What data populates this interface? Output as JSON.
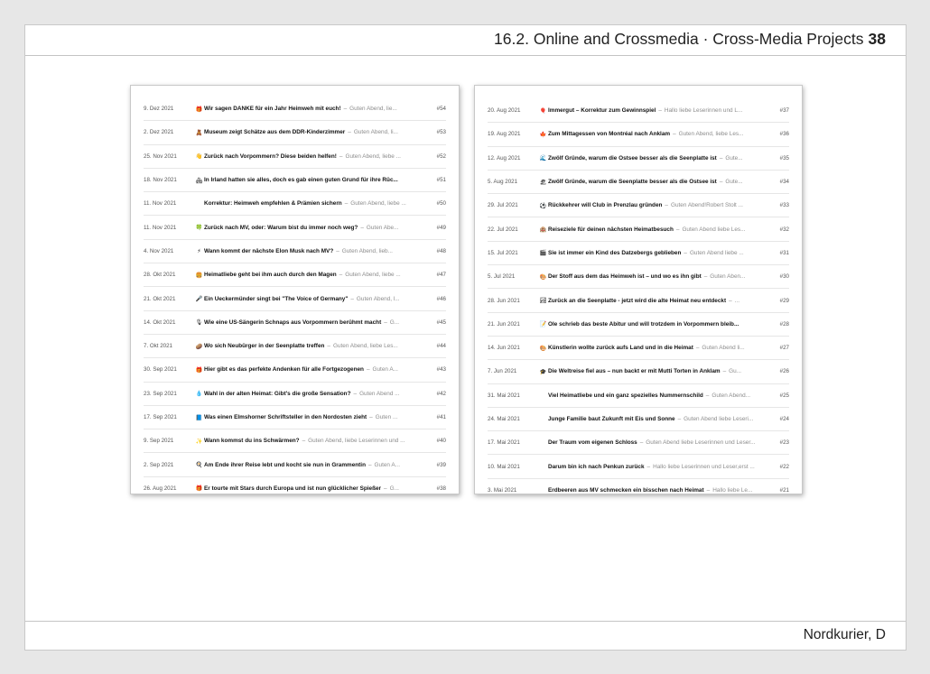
{
  "header": {
    "title": "16.2. Online and Crossmedia · Cross-Media Projects",
    "page": "38"
  },
  "footer": {
    "source": "Nordkurier, D"
  },
  "left_card": {
    "rows": [
      {
        "date": "9. Dez 2021",
        "icon": "🎁",
        "title": "Wir sagen DANKE für ein Jahr Heimweh mit euch!",
        "snippet": "Guten Abend, lie...",
        "num": "#54"
      },
      {
        "date": "2. Dez 2021",
        "icon": "🧸",
        "title": "Museum zeigt Schätze aus dem DDR-Kinderzimmer",
        "snippet": "Guten Abend, li...",
        "num": "#53"
      },
      {
        "date": "25. Nov 2021",
        "icon": "👋",
        "title": "Zurück nach Vorpommern? Diese beiden helfen!",
        "snippet": "Guten Abend, liebe ...",
        "num": "#52"
      },
      {
        "date": "18. Nov 2021",
        "icon": "🏘",
        "title": "In Irland hatten sie alles, doch es gab einen guten Grund für ihre Rüc...",
        "snippet": "",
        "num": "#51"
      },
      {
        "date": "11. Nov 2021",
        "icon": "",
        "title": "Korrektur: Heimweh empfehlen & Prämien sichern",
        "snippet": "Guten Abend, liebe ...",
        "num": "#50"
      },
      {
        "date": "11. Nov 2021",
        "icon": "🍀",
        "title": "Zurück nach MV, oder: Warum bist du immer noch weg?",
        "snippet": "Guten Abe...",
        "num": "#49"
      },
      {
        "date": "4. Nov 2021",
        "icon": "⚡",
        "title": "Wann kommt der nächste Elon Musk nach MV?",
        "snippet": "Guten Abend, lieb...",
        "num": "#48"
      },
      {
        "date": "28. Okt 2021",
        "icon": "🍔",
        "title": "Heimatliebe geht bei ihm auch durch den Magen",
        "snippet": "Guten Abend, liebe ...",
        "num": "#47"
      },
      {
        "date": "21. Okt 2021",
        "icon": "🎤",
        "title": "Ein Ueckermünder singt bei \"The Voice of Germany\"",
        "snippet": "Guten Abend, l...",
        "num": "#46"
      },
      {
        "date": "14. Okt 2021",
        "icon": "🎙",
        "title": "Wie eine US-Sängerin Schnaps aus Vorpommern berühmt macht",
        "snippet": "G...",
        "num": "#45"
      },
      {
        "date": "7. Okt 2021",
        "icon": "🥔",
        "title": "Wo sich Neubürger in der Seenplatte treffen",
        "snippet": "Guten Abend, liebe Les...",
        "num": "#44"
      },
      {
        "date": "30. Sep 2021",
        "icon": "🎁",
        "title": "Hier gibt es das perfekte Andenken für alle Fortgezogenen",
        "snippet": "Guten A...",
        "num": "#43"
      },
      {
        "date": "23. Sep 2021",
        "icon": "💧",
        "title": "Wahl in der alten Heimat: Gibt's die große Sensation?",
        "snippet": "Guten Abend ...",
        "num": "#42"
      },
      {
        "date": "17. Sep 2021",
        "icon": "📘",
        "title": "Was einen Elmshorner Schriftsteller in den Nordosten zieht",
        "snippet": "Guten ...",
        "num": "#41"
      },
      {
        "date": "9. Sep 2021",
        "icon": "✨",
        "title": "Wann kommst du ins Schwärmen?",
        "snippet": "Guten Abend, liebe Leserinnen und ...",
        "num": "#40"
      },
      {
        "date": "2. Sep 2021",
        "icon": "🍳",
        "title": "Am Ende ihrer Reise lebt und kocht sie nun in Grammentin",
        "snippet": "Guten A...",
        "num": "#39"
      },
      {
        "date": "26. Aug 2021",
        "icon": "🎁",
        "title": "Er tourte mit Stars durch Europa und ist nun glücklicher Spießer",
        "snippet": "G...",
        "num": "#38"
      }
    ]
  },
  "right_card": {
    "rows": [
      {
        "date": "20. Aug 2021",
        "icon": "🎈",
        "title": "Immergut – Korrektur zum Gewinnspiel",
        "snippet": "Hallo liebe Leserinnen und L...",
        "num": "#37"
      },
      {
        "date": "19. Aug 2021",
        "icon": "🍁",
        "title": "Zum Mittagessen von Montréal nach Anklam",
        "snippet": "Guten Abend, liebe Les...",
        "num": "#36"
      },
      {
        "date": "12. Aug 2021",
        "icon": "🌊",
        "title": "Zwölf Gründe, warum die Ostsee besser als die Seenplatte ist",
        "snippet": "Gute...",
        "num": "#35"
      },
      {
        "date": "5. Aug 2021",
        "icon": "🏖",
        "title": "Zwölf Gründe, warum die Seenplatte besser als die Ostsee ist",
        "snippet": "Gute...",
        "num": "#34"
      },
      {
        "date": "29. Jul 2021",
        "icon": "⚽",
        "title": "Rückkehrer will Club in Prenzlau gründen",
        "snippet": "Guten Abend!Robert Stolt ...",
        "num": "#33"
      },
      {
        "date": "22. Jul 2021",
        "icon": "🏨",
        "title": "Reiseziele für deinen nächsten Heimatbesuch",
        "snippet": "Guten Abend liebe Les...",
        "num": "#32"
      },
      {
        "date": "15. Jul 2021",
        "icon": "🎬",
        "title": "Sie ist immer ein Kind des Datzebergs geblieben",
        "snippet": "Guten Abend liebe ...",
        "num": "#31"
      },
      {
        "date": "5. Jul 2021",
        "icon": "🎨",
        "title": "Der Stoff aus dem das Heimweh ist – und wo es ihn gibt",
        "snippet": "Guten Aben...",
        "num": "#30"
      },
      {
        "date": "28. Jun 2021",
        "icon": "🏞",
        "title": "Zurück an die Seenplatte - jetzt wird die alte Heimat neu entdeckt",
        "snippet": "...",
        "num": "#29"
      },
      {
        "date": "21. Jun 2021",
        "icon": "📝",
        "title": "Ole schrieb das beste Abitur und will trotzdem in Vorpommern bleib...",
        "snippet": "",
        "num": "#28"
      },
      {
        "date": "14. Jun 2021",
        "icon": "🎨",
        "title": "Künstlerin wollte zurück aufs Land und in die Heimat",
        "snippet": "Guten Abend li...",
        "num": "#27"
      },
      {
        "date": "7. Jun 2021",
        "icon": "🎓",
        "title": "Die Weltreise fiel aus – nun backt er mit Mutti Torten in Anklam",
        "snippet": "Gu...",
        "num": "#26"
      },
      {
        "date": "31. Mai 2021",
        "icon": "",
        "title": "Viel Heimatliebe und ein ganz spezielles Nummernschild",
        "snippet": "Guten Abend...",
        "num": "#25"
      },
      {
        "date": "24. Mai 2021",
        "icon": "",
        "title": "Junge Familie baut Zukunft mit Eis und Sonne",
        "snippet": "Guten Abend liebe Leseri...",
        "num": "#24"
      },
      {
        "date": "17. Mai 2021",
        "icon": "",
        "title": "Der Traum vom eigenen Schloss",
        "snippet": "Guten Abend liebe Leserinnen und Leser...",
        "num": "#23"
      },
      {
        "date": "10. Mai 2021",
        "icon": "",
        "title": "Darum bin ich nach Penkun zurück",
        "snippet": "Hallo liebe Leserinnen und Leser,erst ...",
        "num": "#22"
      },
      {
        "date": "3. Mai 2021",
        "icon": "",
        "title": "Erdbeeren aus MV schmecken ein bisschen nach Heimat",
        "snippet": "Hallo liebe Le...",
        "num": "#21"
      }
    ]
  }
}
